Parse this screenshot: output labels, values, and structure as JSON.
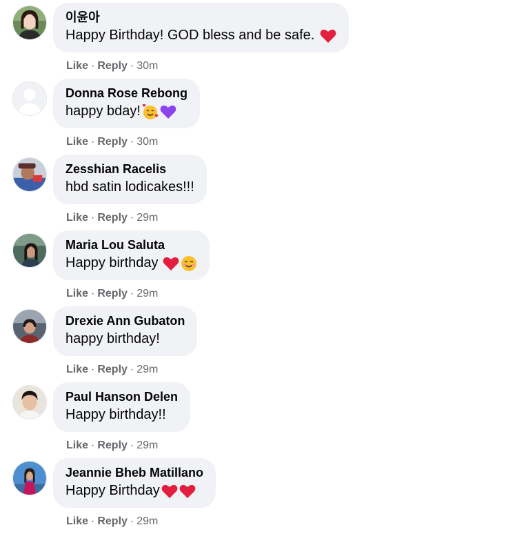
{
  "comments": [
    {
      "name": "이윤아",
      "text": "Happy Birthday! GOD bless and be safe.",
      "emojis": [
        "red-heart"
      ],
      "like": "Like",
      "reply": "Reply",
      "time": "30m",
      "avatar": "profile-photo-woman"
    },
    {
      "name": "Donna Rose Rebong",
      "text": "happy bday!",
      "emojis": [
        "smiling-face-with-hearts",
        "purple-heart"
      ],
      "like": "Like",
      "reply": "Reply",
      "time": "30m",
      "avatar": "default-profile-placeholder"
    },
    {
      "name": "Zesshian Racelis",
      "text": "hbd satin lodicakes!!!",
      "emojis": [],
      "like": "Like",
      "reply": "Reply",
      "time": "29m",
      "avatar": "profile-photo"
    },
    {
      "name": "Maria Lou Saluta",
      "text": "Happy birthday",
      "emojis": [
        "red-heart",
        "smiling-face"
      ],
      "like": "Like",
      "reply": "Reply",
      "time": "29m",
      "avatar": "profile-photo"
    },
    {
      "name": "Drexie Ann Gubaton",
      "text": "happy birthday!",
      "emojis": [],
      "like": "Like",
      "reply": "Reply",
      "time": "29m",
      "avatar": "profile-photo"
    },
    {
      "name": "Paul Hanson Delen",
      "text": "Happy birthday!!",
      "emojis": [],
      "like": "Like",
      "reply": "Reply",
      "time": "29m",
      "avatar": "profile-photo-man"
    },
    {
      "name": "Jeannie Bheb Matillano",
      "text": "Happy Birthday",
      "emojis": [
        "red-heart",
        "red-heart"
      ],
      "like": "Like",
      "reply": "Reply",
      "time": "29m",
      "avatar": "profile-photo"
    }
  ],
  "colors": {
    "bubble": "#f0f2f5",
    "name": "#050505",
    "meta": "#65676b",
    "heart": "#e41e3f",
    "purple_heart": "#8e44ec"
  }
}
